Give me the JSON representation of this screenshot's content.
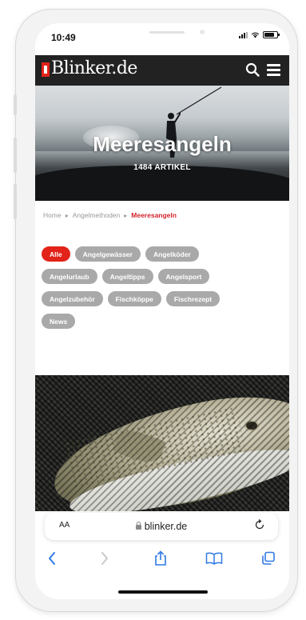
{
  "status_bar": {
    "time": "10:49"
  },
  "site": {
    "logo_text": "Blinker.de"
  },
  "hero": {
    "title": "Meeresangeln",
    "count": "1484 ARTIKEL"
  },
  "breadcrumb": {
    "items": [
      "Home",
      "Angelmethoden",
      "Meeresangeln"
    ]
  },
  "chips": {
    "rows": [
      [
        "Alle",
        "Angelgewässer",
        "Angelköder"
      ],
      [
        "Angelurlaub",
        "Angeltipps",
        "Angelsport"
      ],
      [
        "Angelzubehör",
        "Fischköppe",
        "Fischrezept"
      ],
      [
        "News"
      ]
    ],
    "active": "Alle"
  },
  "browser": {
    "text_size_label": "AA",
    "url": "blinker.de"
  },
  "icons": {
    "search": "search-icon",
    "menu": "hamburger-menu-icon",
    "back": "chevron-left-icon",
    "forward": "chevron-right-icon",
    "share": "share-icon",
    "bookmarks": "book-icon",
    "tabs": "tabs-icon",
    "reload": "reload-icon"
  },
  "colors": {
    "accent": "#e2231a",
    "header_bg": "#222222",
    "chip_bg": "#a9a9a9",
    "toolbar_icon": "#2f7ae5"
  }
}
